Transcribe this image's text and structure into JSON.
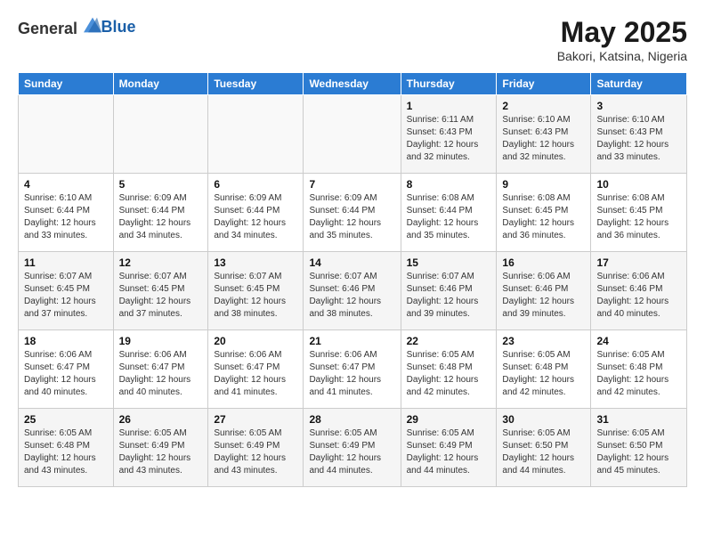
{
  "header": {
    "logo_general": "General",
    "logo_blue": "Blue",
    "title": "May 2025",
    "subtitle": "Bakori, Katsina, Nigeria"
  },
  "days_of_week": [
    "Sunday",
    "Monday",
    "Tuesday",
    "Wednesday",
    "Thursday",
    "Friday",
    "Saturday"
  ],
  "weeks": [
    [
      {
        "num": "",
        "info": ""
      },
      {
        "num": "",
        "info": ""
      },
      {
        "num": "",
        "info": ""
      },
      {
        "num": "",
        "info": ""
      },
      {
        "num": "1",
        "info": "Sunrise: 6:11 AM\nSunset: 6:43 PM\nDaylight: 12 hours\nand 32 minutes."
      },
      {
        "num": "2",
        "info": "Sunrise: 6:10 AM\nSunset: 6:43 PM\nDaylight: 12 hours\nand 32 minutes."
      },
      {
        "num": "3",
        "info": "Sunrise: 6:10 AM\nSunset: 6:43 PM\nDaylight: 12 hours\nand 33 minutes."
      }
    ],
    [
      {
        "num": "4",
        "info": "Sunrise: 6:10 AM\nSunset: 6:44 PM\nDaylight: 12 hours\nand 33 minutes."
      },
      {
        "num": "5",
        "info": "Sunrise: 6:09 AM\nSunset: 6:44 PM\nDaylight: 12 hours\nand 34 minutes."
      },
      {
        "num": "6",
        "info": "Sunrise: 6:09 AM\nSunset: 6:44 PM\nDaylight: 12 hours\nand 34 minutes."
      },
      {
        "num": "7",
        "info": "Sunrise: 6:09 AM\nSunset: 6:44 PM\nDaylight: 12 hours\nand 35 minutes."
      },
      {
        "num": "8",
        "info": "Sunrise: 6:08 AM\nSunset: 6:44 PM\nDaylight: 12 hours\nand 35 minutes."
      },
      {
        "num": "9",
        "info": "Sunrise: 6:08 AM\nSunset: 6:45 PM\nDaylight: 12 hours\nand 36 minutes."
      },
      {
        "num": "10",
        "info": "Sunrise: 6:08 AM\nSunset: 6:45 PM\nDaylight: 12 hours\nand 36 minutes."
      }
    ],
    [
      {
        "num": "11",
        "info": "Sunrise: 6:07 AM\nSunset: 6:45 PM\nDaylight: 12 hours\nand 37 minutes."
      },
      {
        "num": "12",
        "info": "Sunrise: 6:07 AM\nSunset: 6:45 PM\nDaylight: 12 hours\nand 37 minutes."
      },
      {
        "num": "13",
        "info": "Sunrise: 6:07 AM\nSunset: 6:45 PM\nDaylight: 12 hours\nand 38 minutes."
      },
      {
        "num": "14",
        "info": "Sunrise: 6:07 AM\nSunset: 6:46 PM\nDaylight: 12 hours\nand 38 minutes."
      },
      {
        "num": "15",
        "info": "Sunrise: 6:07 AM\nSunset: 6:46 PM\nDaylight: 12 hours\nand 39 minutes."
      },
      {
        "num": "16",
        "info": "Sunrise: 6:06 AM\nSunset: 6:46 PM\nDaylight: 12 hours\nand 39 minutes."
      },
      {
        "num": "17",
        "info": "Sunrise: 6:06 AM\nSunset: 6:46 PM\nDaylight: 12 hours\nand 40 minutes."
      }
    ],
    [
      {
        "num": "18",
        "info": "Sunrise: 6:06 AM\nSunset: 6:47 PM\nDaylight: 12 hours\nand 40 minutes."
      },
      {
        "num": "19",
        "info": "Sunrise: 6:06 AM\nSunset: 6:47 PM\nDaylight: 12 hours\nand 40 minutes."
      },
      {
        "num": "20",
        "info": "Sunrise: 6:06 AM\nSunset: 6:47 PM\nDaylight: 12 hours\nand 41 minutes."
      },
      {
        "num": "21",
        "info": "Sunrise: 6:06 AM\nSunset: 6:47 PM\nDaylight: 12 hours\nand 41 minutes."
      },
      {
        "num": "22",
        "info": "Sunrise: 6:05 AM\nSunset: 6:48 PM\nDaylight: 12 hours\nand 42 minutes."
      },
      {
        "num": "23",
        "info": "Sunrise: 6:05 AM\nSunset: 6:48 PM\nDaylight: 12 hours\nand 42 minutes."
      },
      {
        "num": "24",
        "info": "Sunrise: 6:05 AM\nSunset: 6:48 PM\nDaylight: 12 hours\nand 42 minutes."
      }
    ],
    [
      {
        "num": "25",
        "info": "Sunrise: 6:05 AM\nSunset: 6:48 PM\nDaylight: 12 hours\nand 43 minutes."
      },
      {
        "num": "26",
        "info": "Sunrise: 6:05 AM\nSunset: 6:49 PM\nDaylight: 12 hours\nand 43 minutes."
      },
      {
        "num": "27",
        "info": "Sunrise: 6:05 AM\nSunset: 6:49 PM\nDaylight: 12 hours\nand 43 minutes."
      },
      {
        "num": "28",
        "info": "Sunrise: 6:05 AM\nSunset: 6:49 PM\nDaylight: 12 hours\nand 44 minutes."
      },
      {
        "num": "29",
        "info": "Sunrise: 6:05 AM\nSunset: 6:49 PM\nDaylight: 12 hours\nand 44 minutes."
      },
      {
        "num": "30",
        "info": "Sunrise: 6:05 AM\nSunset: 6:50 PM\nDaylight: 12 hours\nand 44 minutes."
      },
      {
        "num": "31",
        "info": "Sunrise: 6:05 AM\nSunset: 6:50 PM\nDaylight: 12 hours\nand 45 minutes."
      }
    ]
  ]
}
